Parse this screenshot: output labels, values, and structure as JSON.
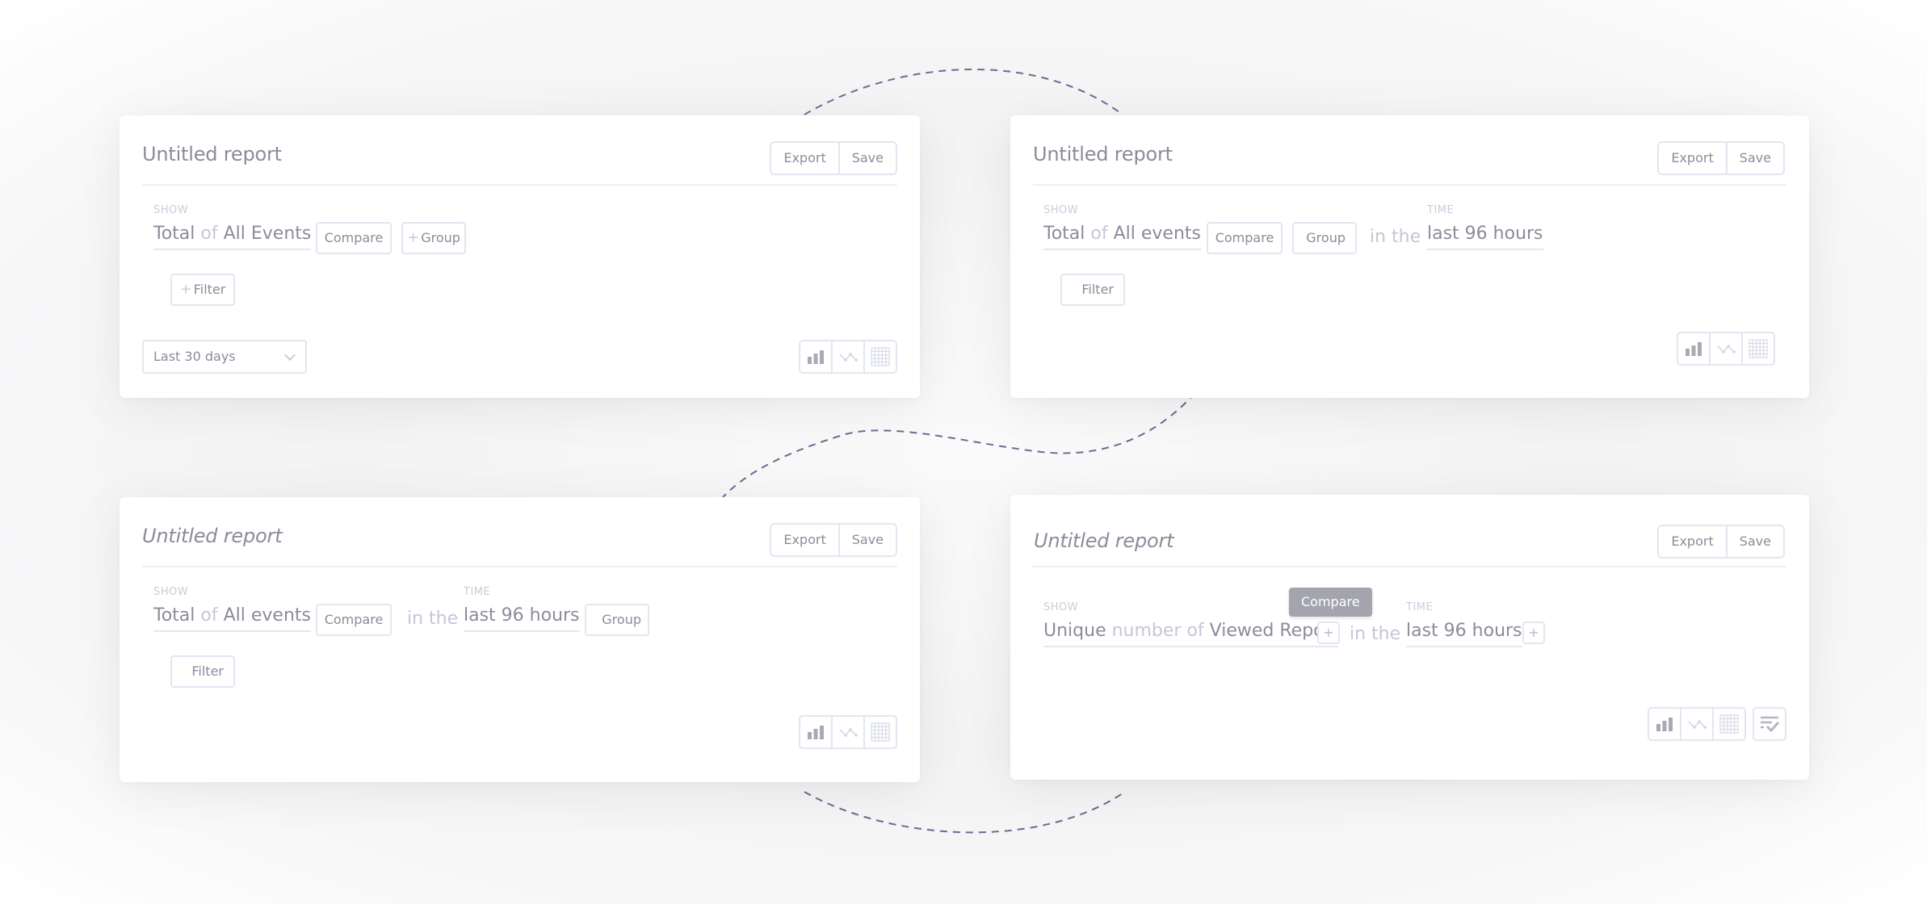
{
  "connectors_color": "#6e6a92",
  "cards": [
    {
      "title": "Untitled report",
      "export_label": "Export",
      "save_label": "Save",
      "show_label": "SHOW",
      "query": {
        "agg": "Total",
        "of": "of",
        "event": "All Events"
      },
      "compare_label": "Compare",
      "group_label": "Group",
      "group_plus": "+",
      "filter_label": "Filter",
      "filter_plus": "+",
      "date_select": "Last 30 days"
    },
    {
      "title": "Untitled report",
      "export_label": "Export",
      "save_label": "Save",
      "show_label": "SHOW",
      "time_label": "TIME",
      "query": {
        "agg": "Total",
        "of": "of",
        "event": "All events"
      },
      "compare_label": "Compare",
      "group_label": "Group",
      "in_the": "in the",
      "time_value": "last 96 hours",
      "filter_label": "Filter"
    },
    {
      "title": "Untitled report",
      "export_label": "Export",
      "save_label": "Save",
      "show_label": "SHOW",
      "time_label": "TIME",
      "query": {
        "agg": "Total",
        "of": "of",
        "event": "All events"
      },
      "compare_label": "Compare",
      "in_the": "in the",
      "time_value": "last 96 hours",
      "group_label": "Group",
      "filter_label": "Filter"
    },
    {
      "title": "Untitled report",
      "export_label": "Export",
      "save_label": "Save",
      "show_label": "SHOW",
      "time_label": "TIME",
      "query": {
        "agg": "Unique",
        "of": "number of",
        "event": "Viewed Report"
      },
      "plus": "+",
      "in_the": "in the",
      "time_value": "last 96 hours",
      "tooltip": "Compare"
    }
  ],
  "viz_icons": [
    "bar-chart-icon",
    "line-chart-icon",
    "table-icon"
  ],
  "extra_icon": "filter-check-icon"
}
